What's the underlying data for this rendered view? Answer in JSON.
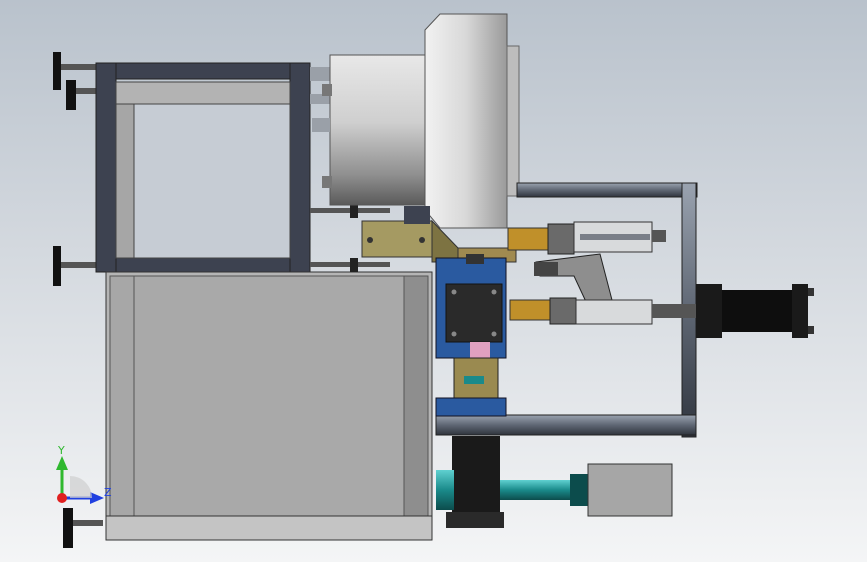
{
  "viewport": {
    "background_top": "#b9c2cc",
    "background_bottom": "#f4f5f6"
  },
  "triad": {
    "x_label": "",
    "y_label": "Y",
    "z_label": "Z",
    "y_color": "#2fb82f",
    "z_color": "#2040e0",
    "x_color": "#e02020"
  },
  "colors": {
    "frame_dark": "#3a3f4a",
    "panel_grey": "#a9a9a9",
    "steel": "#c8c8c8",
    "olive": "#a09060",
    "blue": "#2a5aa0",
    "teal": "#1a8a8a",
    "black_cylinder": "#1a1a1a",
    "brass": "#c0902a"
  }
}
